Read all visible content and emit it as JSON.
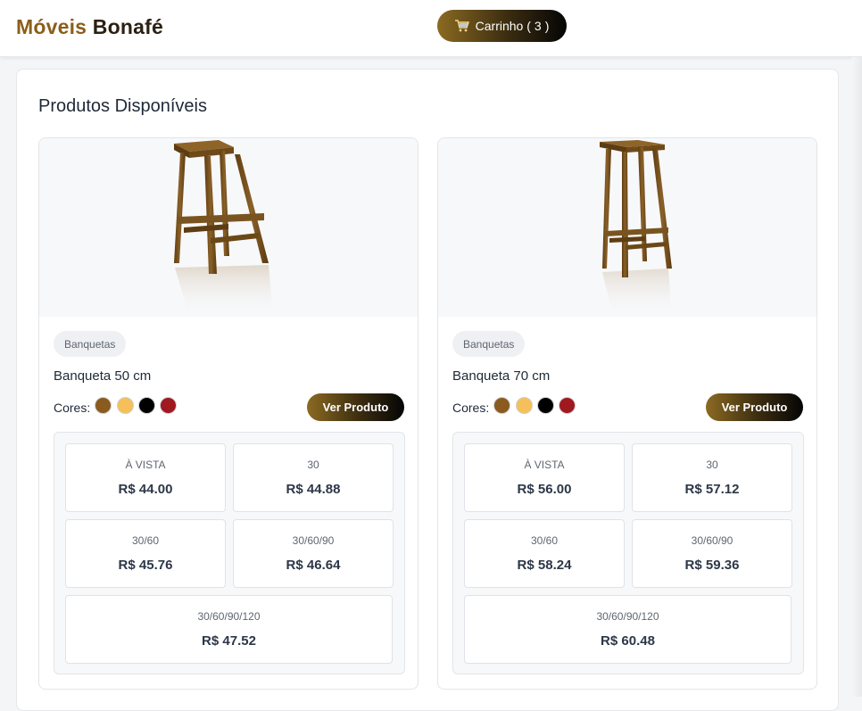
{
  "header": {
    "brand_part1": "Móveis",
    "brand_part2": "Bonafé",
    "cart_label": "Carrinho (",
    "cart_count": "3",
    "cart_close": ")"
  },
  "main": {
    "section_title": "Produtos Disponíveis"
  },
  "products": [
    {
      "category": "Banquetas",
      "name": "Banqueta 50 cm",
      "colors_label": "Cores:",
      "colors": [
        "#8b5a1f",
        "#f5c05a",
        "#000000",
        "#a01820"
      ],
      "view_button": "Ver Produto",
      "prices": [
        {
          "label": "À VISTA",
          "value": "R$ 44.00"
        },
        {
          "label": "30",
          "value": "R$ 44.88"
        },
        {
          "label": "30/60",
          "value": "R$ 45.76"
        },
        {
          "label": "30/60/90",
          "value": "R$ 46.64"
        },
        {
          "label": "30/60/90/120",
          "value": "R$ 47.52"
        }
      ]
    },
    {
      "category": "Banquetas",
      "name": "Banqueta 70 cm",
      "colors_label": "Cores:",
      "colors": [
        "#8b5a1f",
        "#f5c05a",
        "#000000",
        "#a01820"
      ],
      "view_button": "Ver Produto",
      "prices": [
        {
          "label": "À VISTA",
          "value": "R$ 56.00"
        },
        {
          "label": "30",
          "value": "R$ 57.12"
        },
        {
          "label": "30/60",
          "value": "R$ 58.24"
        },
        {
          "label": "30/60/90",
          "value": "R$ 59.36"
        },
        {
          "label": "30/60/90/120",
          "value": "R$ 60.48"
        }
      ]
    }
  ],
  "icons": {
    "cart": "cart-icon"
  },
  "accent_colors": {
    "brand_gold": "#8b5e1a",
    "brand_dark": "#2b2012",
    "button_gradient_start": "#8b6a22",
    "button_gradient_end": "#050505"
  }
}
